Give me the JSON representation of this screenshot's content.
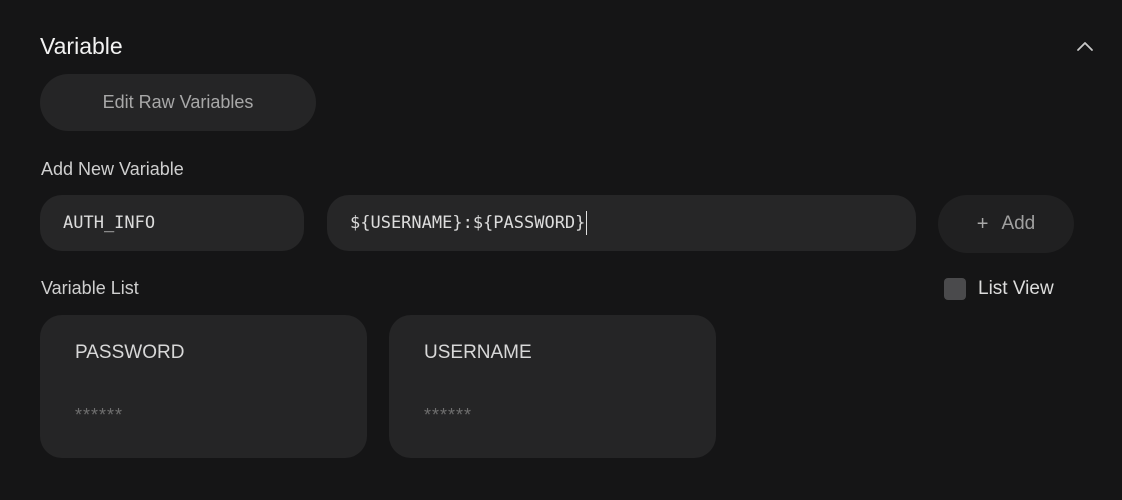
{
  "section": {
    "title": "Variable"
  },
  "toolbar": {
    "edit_raw_label": "Edit Raw Variables"
  },
  "add_new": {
    "label": "Add New Variable",
    "key_value": "AUTH_INFO",
    "value_value": "${USERNAME}:${PASSWORD}",
    "add_label": "Add"
  },
  "variable_list": {
    "label": "Variable List",
    "list_view_label": "List View",
    "list_view_checked": false,
    "items": [
      {
        "name": "PASSWORD",
        "value": "******"
      },
      {
        "name": "USERNAME",
        "value": "******"
      }
    ]
  },
  "icons": {
    "collapse": "chevron-up-icon",
    "add": "plus-icon"
  }
}
